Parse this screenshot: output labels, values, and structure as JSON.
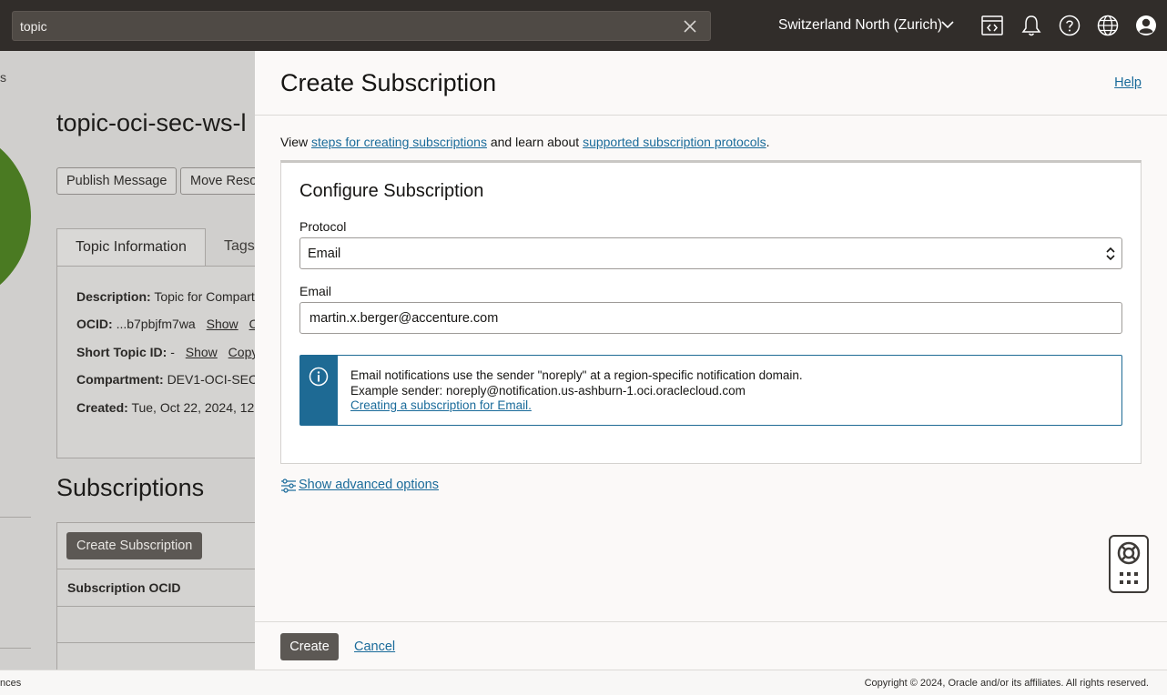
{
  "topbar": {
    "search_value": "topic",
    "region": "Switzerland North (Zurich)",
    "icons": [
      "code-editor-icon",
      "bell-icon",
      "help-icon",
      "globe-icon",
      "profile-icon"
    ]
  },
  "background": {
    "sidebar_fragment": "s",
    "topic_title": "topic-oci-sec-ws-l",
    "buttons": [
      "Publish Message",
      "Move Reso"
    ],
    "tabs": [
      "Topic Information",
      "Tags"
    ],
    "info": {
      "description_label": "Description:",
      "description_value": "Topic for Compart",
      "ocid_label": "OCID:",
      "ocid_value": "...b7pbjfm7wa",
      "ocid_show": "Show",
      "ocid_copy": "C",
      "short_topic_label": "Short Topic ID:",
      "short_topic_value": "-",
      "short_topic_show": "Show",
      "short_topic_copy": "Copy",
      "compartment_label": "Compartment:",
      "compartment_value": "DEV1-OCI-SEC",
      "created_label": "Created:",
      "created_value": "Tue, Oct 22, 2024, 12"
    },
    "subscriptions_title": "Subscriptions",
    "create_subscription_btn": "Create Subscription",
    "column_subscription_ocid": "Subscription OCID"
  },
  "panel": {
    "title": "Create Subscription",
    "help": "Help",
    "intro_prefix": "View ",
    "intro_link1": "steps for creating subscriptions",
    "intro_middle": " and learn about ",
    "intro_link2": "supported subscription protocols",
    "intro_suffix": ".",
    "card_title": "Configure Subscription",
    "protocol_label": "Protocol",
    "protocol_value": "Email",
    "email_label": "Email",
    "email_value": "martin.x.berger@accenture.com",
    "note_line1": "Email notifications use the sender \"noreply\" at a region-specific notification domain.",
    "note_line2": "Example sender: noreply@notification.us-ashburn-1.oci.oraclecloud.com",
    "note_link": "Creating a subscription for Email.",
    "advanced": "Show advanced options",
    "create": "Create",
    "cancel": "Cancel"
  },
  "footer": {
    "left": "nces",
    "right": "Copyright © 2024, Oracle and/or its affiliates. All rights reserved."
  },
  "colors": {
    "topbar": "#312d2a",
    "link": "#1a6b9a",
    "info_accent": "#1e6a94",
    "primary_button": "#5c5854"
  }
}
